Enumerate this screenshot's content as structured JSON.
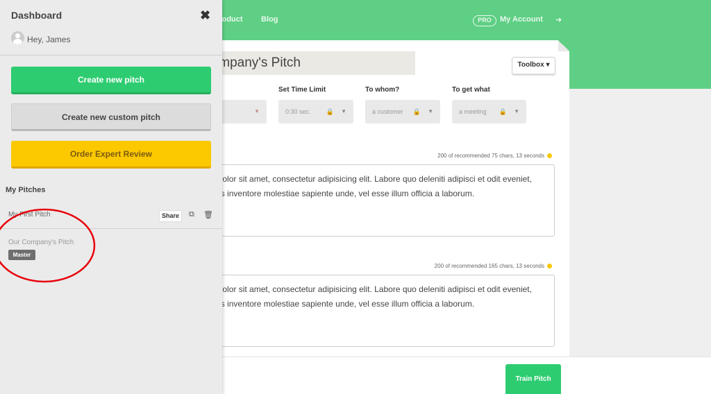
{
  "nav": {
    "product": "Product",
    "blog": "Blog",
    "pro_badge": "PRO",
    "account": "My Account",
    "logout_icon": "sign-out-icon"
  },
  "editor": {
    "title": "Our Company's Pitch",
    "toolbox_label": "Toolbox ▾",
    "fields": [
      {
        "label": "",
        "value": ""
      },
      {
        "label": "Set Time Limit",
        "value": "0:30 sec."
      },
      {
        "label": "To whom?",
        "value": "a customer"
      },
      {
        "label": "To get what",
        "value": "a meeting"
      }
    ],
    "sections": [
      {
        "counter": "200 of recommended 75 chars, 13 seconds",
        "status_color": "#f9c700",
        "lines": [
          "Lorem ipsum dolor sit amet, consectetur adipisicing elit. Labore quo deleniti adipisci et odit eveniet,",
          "eaque in veritatis inventore molestiae sapiente unde, vel esse illum officia a laborum."
        ]
      },
      {
        "counter": "200 of recommended 165 chars, 13 seconds",
        "status_color": "#f9c700",
        "lines": [
          "Lorem ipsum dolor sit amet, consectetur adipisicing elit. Labore quo deleniti adipisci et odit eveniet,",
          "eaque in veritatis inventore molestiae sapiente unde, vel esse illum officia a laborum."
        ]
      }
    ],
    "train_label": "Train Pitch"
  },
  "sidebar": {
    "title": "Dashboard",
    "close_icon": "close-icon",
    "greeting": "Hey, James",
    "buttons": {
      "create_new": "Create new pitch",
      "create_custom": "Create new custom pitch",
      "order_review": "Order Expert Review"
    },
    "section_title": "My Pitches",
    "pitches": [
      {
        "name": "My First Pitch",
        "share_label": "Share"
      },
      {
        "name": "Our Company's Pitch",
        "badge": "Master"
      }
    ]
  },
  "colors": {
    "brand_green": "#5ecf84",
    "button_green": "#2ecc71",
    "button_yellow": "#fcc800",
    "annotation_red": "#e8000b"
  }
}
